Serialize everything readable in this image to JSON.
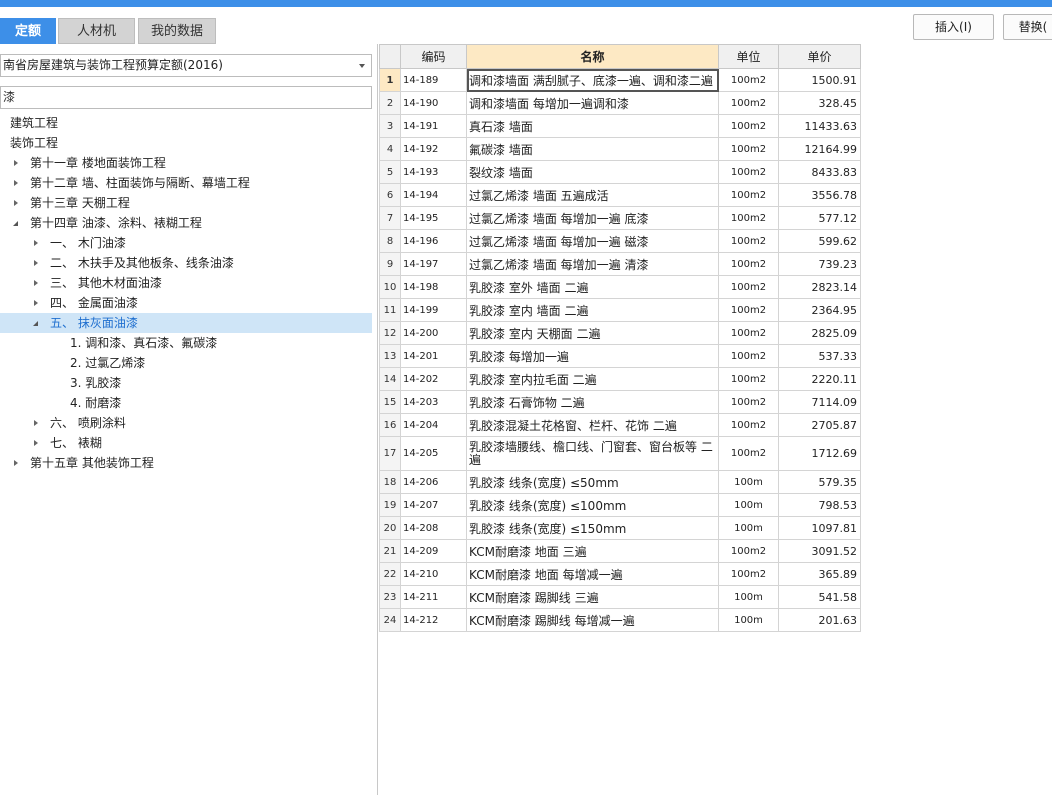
{
  "tabs": [
    "定额",
    "人材机",
    "我的数据"
  ],
  "toolbar": {
    "insert_label": "插入(I)",
    "replace_label": "替换("
  },
  "left": {
    "selector_value": "南省房屋建筑与装饰工程预算定额(2016)",
    "search_value": "漆",
    "tree": [
      {
        "label": "建筑工程"
      },
      {
        "label": "装饰工程"
      },
      {
        "label": "第十一章 楼地面装饰工程"
      },
      {
        "label": "第十二章 墙、柱面装饰与隔断、幕墙工程"
      },
      {
        "label": "第十三章 天棚工程"
      },
      {
        "label": "第十四章 油漆、涂料、裱糊工程"
      },
      {
        "label": "一、  木门油漆"
      },
      {
        "label": "二、  木扶手及其他板条、线条油漆"
      },
      {
        "label": "三、  其他木材面油漆"
      },
      {
        "label": "四、  金属面油漆"
      },
      {
        "label": "五、  抹灰面油漆"
      },
      {
        "label": "1. 调和漆、真石漆、氟碳漆"
      },
      {
        "label": "2. 过氯乙烯漆"
      },
      {
        "label": "3. 乳胶漆"
      },
      {
        "label": "4. 耐磨漆"
      },
      {
        "label": "六、  喷刷涂料"
      },
      {
        "label": "七、  裱糊"
      },
      {
        "label": "第十五章 其他装饰工程"
      }
    ]
  },
  "table": {
    "columns": [
      "编码",
      "名称",
      "单位",
      "单价"
    ],
    "rows": [
      {
        "no": "1",
        "code": "14-189",
        "name": "调和漆墙面 满刮腻子、底漆一遍、调和漆二遍",
        "unit": "100m2",
        "price": "1500.91"
      },
      {
        "no": "2",
        "code": "14-190",
        "name": "调和漆墙面 每增加一遍调和漆",
        "unit": "100m2",
        "price": "328.45"
      },
      {
        "no": "3",
        "code": "14-191",
        "name": "真石漆 墙面",
        "unit": "100m2",
        "price": "11433.63"
      },
      {
        "no": "4",
        "code": "14-192",
        "name": "氟碳漆 墙面",
        "unit": "100m2",
        "price": "12164.99"
      },
      {
        "no": "5",
        "code": "14-193",
        "name": "裂纹漆 墙面",
        "unit": "100m2",
        "price": "8433.83"
      },
      {
        "no": "6",
        "code": "14-194",
        "name": "过氯乙烯漆 墙面 五遍成活",
        "unit": "100m2",
        "price": "3556.78"
      },
      {
        "no": "7",
        "code": "14-195",
        "name": "过氯乙烯漆 墙面 每增加一遍 底漆",
        "unit": "100m2",
        "price": "577.12"
      },
      {
        "no": "8",
        "code": "14-196",
        "name": "过氯乙烯漆 墙面 每增加一遍 磁漆",
        "unit": "100m2",
        "price": "599.62"
      },
      {
        "no": "9",
        "code": "14-197",
        "name": "过氯乙烯漆 墙面 每增加一遍 清漆",
        "unit": "100m2",
        "price": "739.23"
      },
      {
        "no": "10",
        "code": "14-198",
        "name": "乳胶漆 室外 墙面 二遍",
        "unit": "100m2",
        "price": "2823.14"
      },
      {
        "no": "11",
        "code": "14-199",
        "name": "乳胶漆 室内 墙面 二遍",
        "unit": "100m2",
        "price": "2364.95"
      },
      {
        "no": "12",
        "code": "14-200",
        "name": "乳胶漆 室内 天棚面 二遍",
        "unit": "100m2",
        "price": "2825.09"
      },
      {
        "no": "13",
        "code": "14-201",
        "name": "乳胶漆 每增加一遍",
        "unit": "100m2",
        "price": "537.33"
      },
      {
        "no": "14",
        "code": "14-202",
        "name": "乳胶漆 室内拉毛面 二遍",
        "unit": "100m2",
        "price": "2220.11"
      },
      {
        "no": "15",
        "code": "14-203",
        "name": "乳胶漆 石膏饰物 二遍",
        "unit": "100m2",
        "price": "7114.09"
      },
      {
        "no": "16",
        "code": "14-204",
        "name": "乳胶漆混凝土花格窗、栏杆、花饰 二遍",
        "unit": "100m2",
        "price": "2705.87"
      },
      {
        "no": "17",
        "code": "14-205",
        "name": "乳胶漆墙腰线、檐口线、门窗套、窗台板等 二遍",
        "unit": "100m2",
        "price": "1712.69"
      },
      {
        "no": "18",
        "code": "14-206",
        "name": "乳胶漆 线条(宽度) ≤50mm",
        "unit": "100m",
        "price": "579.35"
      },
      {
        "no": "19",
        "code": "14-207",
        "name": "乳胶漆 线条(宽度) ≤100mm",
        "unit": "100m",
        "price": "798.53"
      },
      {
        "no": "20",
        "code": "14-208",
        "name": "乳胶漆 线条(宽度) ≤150mm",
        "unit": "100m",
        "price": "1097.81"
      },
      {
        "no": "21",
        "code": "14-209",
        "name": "KCM耐磨漆 地面 三遍",
        "unit": "100m2",
        "price": "3091.52"
      },
      {
        "no": "22",
        "code": "14-210",
        "name": "KCM耐磨漆 地面 每增减一遍",
        "unit": "100m2",
        "price": "365.89"
      },
      {
        "no": "23",
        "code": "14-211",
        "name": "KCM耐磨漆 踢脚线 三遍",
        "unit": "100m",
        "price": "541.58"
      },
      {
        "no": "24",
        "code": "14-212",
        "name": "KCM耐磨漆 踢脚线 每增减一遍",
        "unit": "100m",
        "price": "201.63"
      }
    ]
  },
  "colors": {
    "accent": "#3d8fe8",
    "selected_row": "#cfe5f7",
    "header_highlight": "#fde9c4"
  }
}
